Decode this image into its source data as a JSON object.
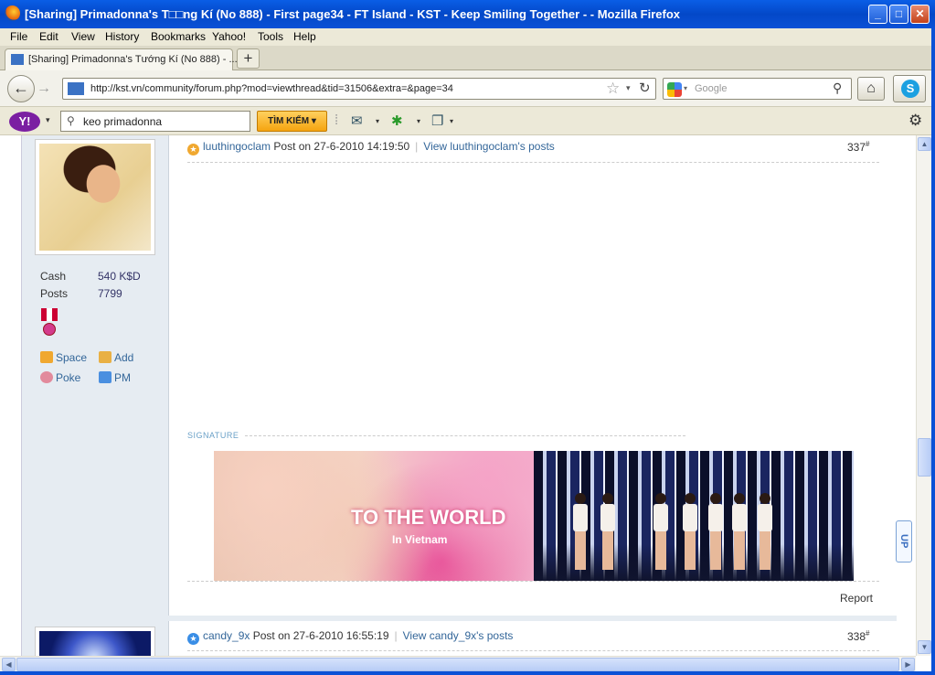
{
  "window": {
    "title": "[Sharing] Primadonna's T□□ng Kí (No 888) - First page34 - FT Island - KST - Keep Smiling Together - - Mozilla Firefox",
    "min": "_",
    "max": "□",
    "close": "✕"
  },
  "menu": [
    "File",
    "Edit",
    "View",
    "History",
    "Bookmarks",
    "Yahoo!",
    "Tools",
    "Help"
  ],
  "tabs": [
    {
      "label": "[Sharing] Primadonna's Tướng Kí (No 888) - ..."
    }
  ],
  "new_tab": "+",
  "nav": {
    "back": "←",
    "forward": "→",
    "url": "http://kst.vn/community/forum.php?mod=viewthread&tid=31506&extra=&page=34",
    "bookmark_star": "☆",
    "url_dropdown": "▾",
    "reload": "↻",
    "search_placeholder": "Google",
    "search_dropdown": "▾",
    "search_icon": "⚲",
    "home": "⌂",
    "skype": "S"
  },
  "yahoo_toolbar": {
    "logo": "Y!",
    "logo_dropdown": "▾",
    "search_icon": "⚲",
    "query": "keo primadonna",
    "search_button": "TÌM KIẾM ▾",
    "divider": "⁞",
    "mail_icon": "✉",
    "tool_dropdown": "▾",
    "answers_icon": "✱",
    "pages_icon": "❐",
    "gear": "⚙"
  },
  "post1": {
    "author": "luuthingoclam",
    "post_on": "Post on 27-6-2010 14:19:50",
    "separator": "|",
    "view_posts": "View luuthingoclam's posts",
    "number": "337",
    "number_sup": "#",
    "signature_label": "SIGNATURE",
    "sig_line1": "TO THE WORLD",
    "sig_line2": "In Vietnam",
    "report": "Report"
  },
  "user1": {
    "cash_label": "Cash",
    "cash_value": "540 K$D",
    "posts_label": "Posts",
    "posts_value": "7799",
    "links": {
      "space": "Space",
      "add": "Add",
      "poke": "Poke",
      "pm": "PM"
    }
  },
  "post2": {
    "author": "candy_9x",
    "post_on": "Post on 27-6-2010 16:55:19",
    "separator": "|",
    "view_posts": "View candy_9x's posts",
    "number": "338",
    "number_sup": "#"
  },
  "up_button": "UP",
  "scroll": {
    "up": "▲",
    "down": "▼",
    "left": "◀",
    "right": "▶"
  }
}
